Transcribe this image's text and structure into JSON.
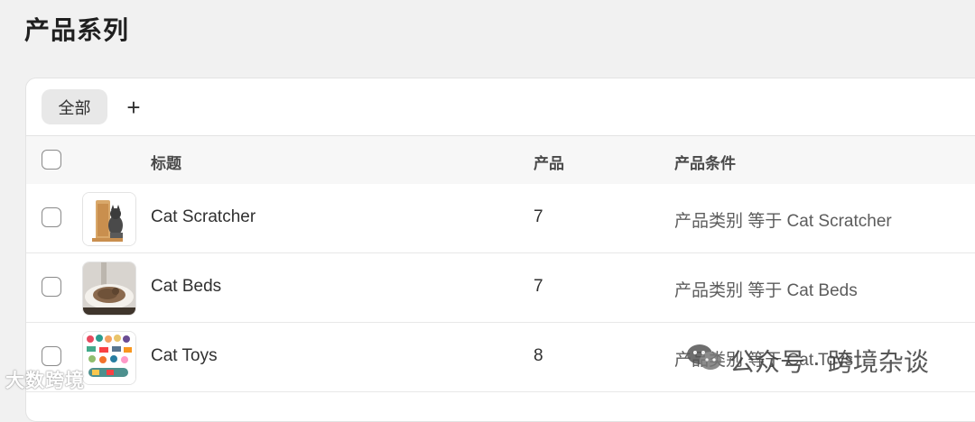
{
  "page": {
    "title": "产品系列"
  },
  "tabs": {
    "all_label": "全部",
    "add_label": "+"
  },
  "table": {
    "headers": {
      "title": "标题",
      "products": "产品",
      "conditions": "产品条件"
    },
    "rows": [
      {
        "title": "Cat Scratcher",
        "count": "7",
        "condition": "产品类别 等于 Cat Scratcher",
        "thumb": "cat-scratcher-thumbnail"
      },
      {
        "title": "Cat Beds",
        "count": "7",
        "condition": "产品类别 等于 Cat Beds",
        "thumb": "cat-bed-thumbnail"
      },
      {
        "title": "Cat Toys",
        "count": "8",
        "condition": "产品类别 等于 Cat Toys",
        "thumb": "cat-toys-thumbnail"
      }
    ]
  },
  "watermark": {
    "left": "大数跨境",
    "right": "公众号 · 跨境杂谈"
  },
  "colors": {
    "background": "#f1f1f1",
    "card": "#ffffff",
    "header": "#f7f7f7",
    "tab_active": "#e8e8e8"
  }
}
